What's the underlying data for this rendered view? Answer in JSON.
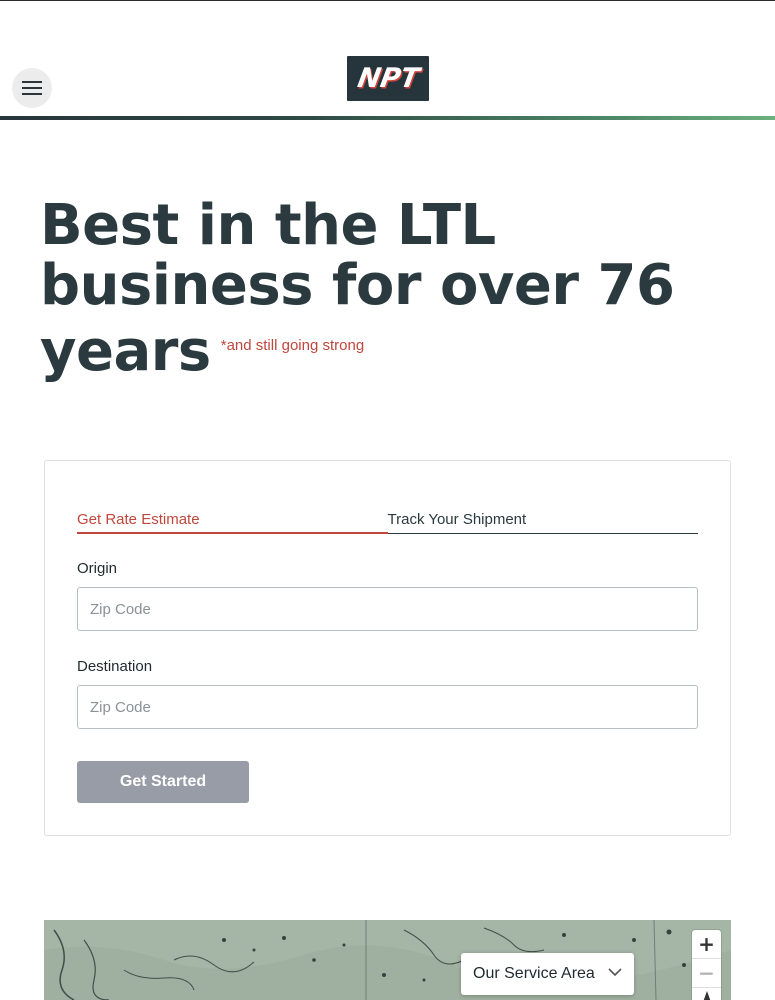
{
  "header": {
    "logo_text": "NPT",
    "menu_icon": "hamburger-menu-icon",
    "brand_colors": {
      "dark": "#26353b",
      "accent_red": "#c0473c",
      "accent_green": "#6eb07e"
    }
  },
  "hero": {
    "title": "Best in the LTL business for over 76 years",
    "note": "*and still going strong"
  },
  "rate_form": {
    "tabs": [
      {
        "label": "Get Rate Estimate",
        "active": true
      },
      {
        "label": "Track Your Shipment",
        "active": false
      }
    ],
    "origin": {
      "label": "Origin",
      "placeholder": "Zip Code",
      "value": ""
    },
    "destination": {
      "label": "Destination",
      "placeholder": "Zip Code",
      "value": ""
    },
    "submit_label": "Get Started",
    "submit_state": "disabled"
  },
  "map": {
    "area_select_label": "Our Service Area",
    "zoom_in": "+",
    "zoom_out": "−",
    "compass_icon": "compass-north-icon",
    "chevron_icon": "chevron-down-icon"
  }
}
